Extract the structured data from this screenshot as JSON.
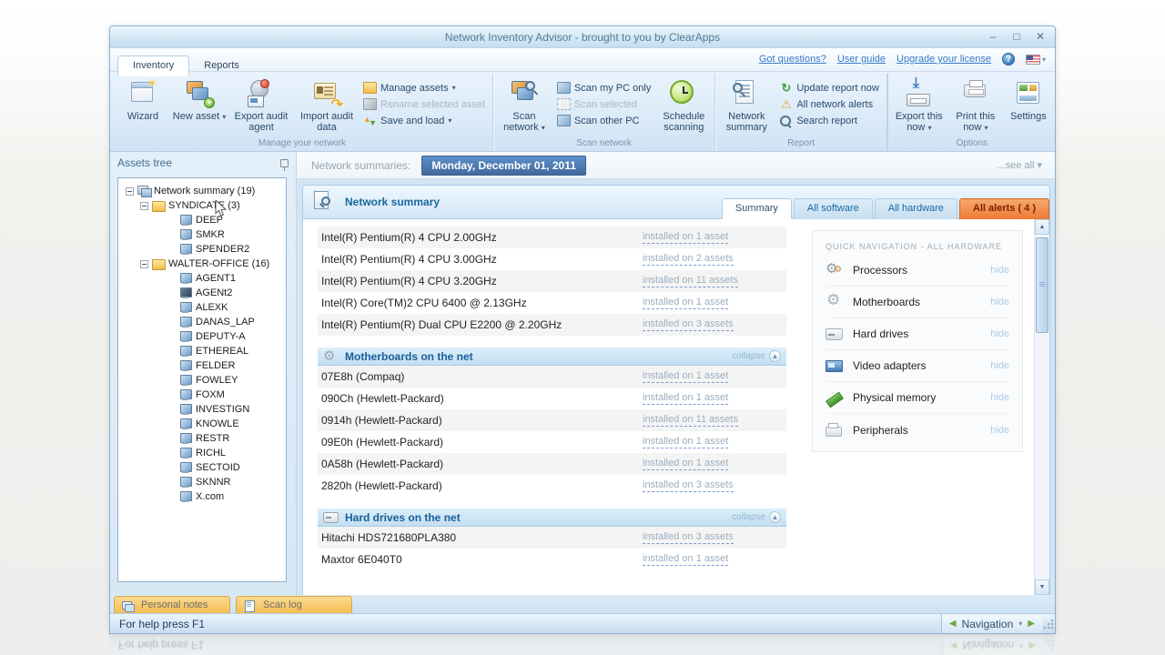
{
  "colors": {
    "accent_blue": "#4e84c0",
    "alert_orange": "#ee7b35",
    "link_blue": "#3b7bc8",
    "tab_yellow": "#f5bd55"
  },
  "window": {
    "title": "Network Inventory Advisor - brought to you by ClearApps"
  },
  "titlebar": {
    "minimize": "–",
    "maximize": "□",
    "close": "✕"
  },
  "menubar": {
    "tabs": [
      {
        "label": "Inventory",
        "cls": "active"
      },
      {
        "label": "Reports",
        "cls": ""
      }
    ],
    "links": [
      {
        "label": "Got questions?"
      },
      {
        "label": "User guide"
      },
      {
        "label": "Upgrade your license"
      }
    ],
    "help": "?"
  },
  "ribbon": {
    "manage": {
      "group_label": "Manage your network",
      "wizard": "Wizard",
      "new_asset": "New asset",
      "export_audit_agent": "Export audit agent",
      "import_audit_data": "Import audit data",
      "manage_assets": "Manage assets",
      "rename_selected": "Rename selected asset",
      "save_and_load": "Save and load"
    },
    "scan": {
      "group_label": "Scan network",
      "scan_network": "Scan network",
      "scan_my_pc": "Scan my PC only",
      "scan_selected": "Scan selected",
      "scan_other": "Scan other PC",
      "schedule": "Schedule scanning"
    },
    "report": {
      "group_label": "Report",
      "network_summary": "Network summary",
      "update_now": "Update report now",
      "alerts": "All network alerts",
      "search": "Search report"
    },
    "options": {
      "group_label": "Options",
      "export_now": "Export this now",
      "print_now": "Print this now",
      "settings": "Settings"
    }
  },
  "assets_tree": {
    "header": "Assets tree",
    "items": [
      {
        "label": "Network summary (19)",
        "cls": "lvl0 ic-net exp"
      },
      {
        "label": "SYNDICATE (3)",
        "cls": "lvl1 ic-folder exp"
      },
      {
        "label": "DEEP",
        "cls": "lvl2 ic-pc"
      },
      {
        "label": "SMKR",
        "cls": "lvl2 ic-pc"
      },
      {
        "label": "SPENDER2",
        "cls": "lvl2 ic-pc"
      },
      {
        "label": "WALTER-OFFICE (16)",
        "cls": "lvl1 ic-folder exp"
      },
      {
        "label": "AGENT1",
        "cls": "lvl2 ic-pc"
      },
      {
        "label": "AGENt2",
        "cls": "lvl2 ic-pc2"
      },
      {
        "label": "ALEXK",
        "cls": "lvl2 ic-pc"
      },
      {
        "label": "DANAS_LAP",
        "cls": "lvl2 ic-pc"
      },
      {
        "label": "DEPUTY-A",
        "cls": "lvl2 ic-pc"
      },
      {
        "label": "ETHEREAL",
        "cls": "lvl2 ic-pc"
      },
      {
        "label": "FELDER",
        "cls": "lvl2 ic-pc"
      },
      {
        "label": "FOWLEY",
        "cls": "lvl2 ic-pc"
      },
      {
        "label": "FOXM",
        "cls": "lvl2 ic-pc"
      },
      {
        "label": "INVESTIGN",
        "cls": "lvl2 ic-pc"
      },
      {
        "label": "KNOWLE",
        "cls": "lvl2 ic-pc"
      },
      {
        "label": "RESTR",
        "cls": "lvl2 ic-pc"
      },
      {
        "label": "RICHL",
        "cls": "lvl2 ic-pc"
      },
      {
        "label": "SECTOID",
        "cls": "lvl2 ic-pc"
      },
      {
        "label": "SKNNR",
        "cls": "lvl2 ic-pc"
      },
      {
        "label": "X.com",
        "cls": "lvl2 ic-pc"
      }
    ]
  },
  "summary_bar": {
    "label": "Network summaries:",
    "date": "Monday, December 01, 2011",
    "see_all": "...see all ▾"
  },
  "report_view": {
    "title": "Network summary",
    "tabs": [
      {
        "label": "Summary",
        "cls": "active"
      },
      {
        "label": "All software",
        "cls": ""
      },
      {
        "label": "All hardware",
        "cls": ""
      },
      {
        "label": "All alerts ( 4 )",
        "cls": "alert"
      }
    ],
    "processors_rows": [
      {
        "name": "Intel(R) Pentium(R) 4 CPU 2.00GHz",
        "installed": "installed on 1 asset"
      },
      {
        "name": "Intel(R) Pentium(R) 4 CPU 3.00GHz",
        "installed": "installed on 2 assets"
      },
      {
        "name": "Intel(R) Pentium(R) 4 CPU 3.20GHz",
        "installed": "installed on 11 assets"
      },
      {
        "name": "Intel(R) Core(TM)2 CPU 6400 @ 2.13GHz",
        "installed": "installed on 1 asset"
      },
      {
        "name": "Intel(R) Pentium(R) Dual CPU E2200 @ 2.20GHz",
        "installed": "installed on 3 assets"
      }
    ],
    "motherboards": {
      "title": "Motherboards on the net",
      "collapse": "collapse",
      "rows": [
        {
          "name": "07E8h (Compaq)",
          "installed": "installed on 1 asset"
        },
        {
          "name": "090Ch (Hewlett-Packard)",
          "installed": "installed on 1 asset"
        },
        {
          "name": "0914h (Hewlett-Packard)",
          "installed": "installed on 11 assets"
        },
        {
          "name": "09E0h (Hewlett-Packard)",
          "installed": "installed on 1 asset"
        },
        {
          "name": "0A58h (Hewlett-Packard)",
          "installed": "installed on 1 asset"
        },
        {
          "name": "2820h (Hewlett-Packard)",
          "installed": "installed on 3 assets"
        }
      ]
    },
    "hard_drives": {
      "title": "Hard drives on the net",
      "collapse": "collapse",
      "rows": [
        {
          "name": "Hitachi HDS721680PLA380",
          "installed": "installed on 3 assets"
        },
        {
          "name": "Maxtor 6E040T0",
          "installed": "installed on 1 asset"
        }
      ]
    },
    "quick_nav": {
      "title": "QUICK NAVIGATION - ALL HARDWARE",
      "items": [
        {
          "label": "Processors",
          "hide": "hide",
          "icon": "qi-proc"
        },
        {
          "label": "Motherboards",
          "hide": "hide",
          "icon": "qi-mobo"
        },
        {
          "label": "Hard drives",
          "hide": "hide",
          "icon": "qi-hdd"
        },
        {
          "label": "Video adapters",
          "hide": "hide",
          "icon": "qi-video"
        },
        {
          "label": "Physical memory",
          "hide": "hide",
          "icon": "qi-ram"
        },
        {
          "label": "Peripherals",
          "hide": "hide",
          "icon": "qi-periph"
        }
      ]
    }
  },
  "bottom_tabs": [
    {
      "label": "Personal notes",
      "icon": "bt-notes"
    },
    {
      "label": "Scan log",
      "icon": "bt-log"
    }
  ],
  "status_bar": {
    "help": "For help press F1",
    "navigation": "Navigation"
  }
}
